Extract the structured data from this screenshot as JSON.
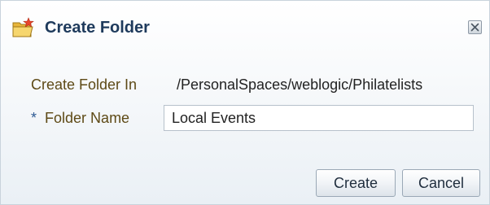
{
  "dialog": {
    "title": "Create Folder",
    "title_icon": "new-folder-icon",
    "close_icon": "close-icon"
  },
  "form": {
    "create_in_label": "Create Folder In",
    "create_in_value": "/PersonalSpaces/weblogic/Philatelists",
    "required_marker": "*",
    "folder_name_label": "Folder Name",
    "folder_name_value": "Local Events"
  },
  "buttons": {
    "create_label": "Create",
    "cancel_label": "Cancel"
  },
  "colors": {
    "title": "#1e3a5c",
    "label": "#5e4a16",
    "required": "#2e5a94",
    "folder_icon": "#f0c64a"
  }
}
